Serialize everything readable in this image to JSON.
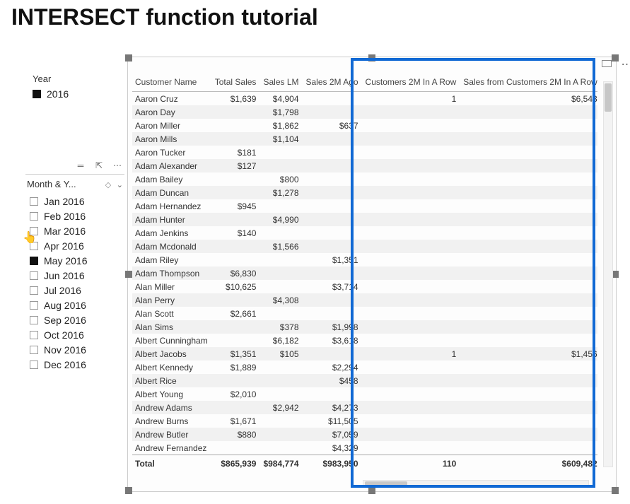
{
  "page": {
    "title": "INTERSECT function tutorial"
  },
  "year_slicer": {
    "label": "Year",
    "items": [
      {
        "label": "2016",
        "selected": true
      }
    ]
  },
  "month_slicer": {
    "title": "Month & Y...",
    "items": [
      {
        "label": "Jan 2016",
        "selected": false
      },
      {
        "label": "Feb 2016",
        "selected": false
      },
      {
        "label": "Mar 2016",
        "selected": false
      },
      {
        "label": "Apr 2016",
        "selected": false
      },
      {
        "label": "May 2016",
        "selected": true
      },
      {
        "label": "Jun 2016",
        "selected": false
      },
      {
        "label": "Jul 2016",
        "selected": false
      },
      {
        "label": "Aug 2016",
        "selected": false
      },
      {
        "label": "Sep 2016",
        "selected": false
      },
      {
        "label": "Oct 2016",
        "selected": false
      },
      {
        "label": "Nov 2016",
        "selected": false
      },
      {
        "label": "Dec 2016",
        "selected": false
      }
    ]
  },
  "table": {
    "columns": [
      "Customer Name",
      "Total Sales",
      "Sales LM",
      "Sales 2M Ago",
      "Customers 2M In A Row",
      "Sales from Customers 2M In A Row"
    ],
    "rows": [
      {
        "name": "Aaron Cruz",
        "total": "$1,639",
        "lm": "$4,904",
        "ago": "",
        "cr": "1",
        "sf": "$6,543"
      },
      {
        "name": "Aaron Day",
        "total": "",
        "lm": "$1,798",
        "ago": "",
        "cr": "",
        "sf": ""
      },
      {
        "name": "Aaron Miller",
        "total": "",
        "lm": "$1,862",
        "ago": "$637",
        "cr": "",
        "sf": ""
      },
      {
        "name": "Aaron Mills",
        "total": "",
        "lm": "$1,104",
        "ago": "",
        "cr": "",
        "sf": ""
      },
      {
        "name": "Aaron Tucker",
        "total": "$181",
        "lm": "",
        "ago": "",
        "cr": "",
        "sf": ""
      },
      {
        "name": "Adam Alexander",
        "total": "$127",
        "lm": "",
        "ago": "",
        "cr": "",
        "sf": ""
      },
      {
        "name": "Adam Bailey",
        "total": "",
        "lm": "$800",
        "ago": "",
        "cr": "",
        "sf": ""
      },
      {
        "name": "Adam Duncan",
        "total": "",
        "lm": "$1,278",
        "ago": "",
        "cr": "",
        "sf": ""
      },
      {
        "name": "Adam Hernandez",
        "total": "$945",
        "lm": "",
        "ago": "",
        "cr": "",
        "sf": ""
      },
      {
        "name": "Adam Hunter",
        "total": "",
        "lm": "$4,990",
        "ago": "",
        "cr": "",
        "sf": ""
      },
      {
        "name": "Adam Jenkins",
        "total": "$140",
        "lm": "",
        "ago": "",
        "cr": "",
        "sf": ""
      },
      {
        "name": "Adam Mcdonald",
        "total": "",
        "lm": "$1,566",
        "ago": "",
        "cr": "",
        "sf": ""
      },
      {
        "name": "Adam Riley",
        "total": "",
        "lm": "",
        "ago": "$1,351",
        "cr": "",
        "sf": ""
      },
      {
        "name": "Adam Thompson",
        "total": "$6,830",
        "lm": "",
        "ago": "",
        "cr": "",
        "sf": ""
      },
      {
        "name": "Alan Miller",
        "total": "$10,625",
        "lm": "",
        "ago": "$3,714",
        "cr": "",
        "sf": ""
      },
      {
        "name": "Alan Perry",
        "total": "",
        "lm": "$4,308",
        "ago": "",
        "cr": "",
        "sf": ""
      },
      {
        "name": "Alan Scott",
        "total": "$2,661",
        "lm": "",
        "ago": "",
        "cr": "",
        "sf": ""
      },
      {
        "name": "Alan Sims",
        "total": "",
        "lm": "$378",
        "ago": "$1,998",
        "cr": "",
        "sf": ""
      },
      {
        "name": "Albert Cunningham",
        "total": "",
        "lm": "$6,182",
        "ago": "$3,618",
        "cr": "",
        "sf": ""
      },
      {
        "name": "Albert Jacobs",
        "total": "$1,351",
        "lm": "$105",
        "ago": "",
        "cr": "1",
        "sf": "$1,456"
      },
      {
        "name": "Albert Kennedy",
        "total": "$1,889",
        "lm": "",
        "ago": "$2,294",
        "cr": "",
        "sf": ""
      },
      {
        "name": "Albert Rice",
        "total": "",
        "lm": "",
        "ago": "$458",
        "cr": "",
        "sf": ""
      },
      {
        "name": "Albert Young",
        "total": "$2,010",
        "lm": "",
        "ago": "",
        "cr": "",
        "sf": ""
      },
      {
        "name": "Andrew Adams",
        "total": "",
        "lm": "$2,942",
        "ago": "$4,273",
        "cr": "",
        "sf": ""
      },
      {
        "name": "Andrew Burns",
        "total": "$1,671",
        "lm": "",
        "ago": "$11,505",
        "cr": "",
        "sf": ""
      },
      {
        "name": "Andrew Butler",
        "total": "$880",
        "lm": "",
        "ago": "$7,059",
        "cr": "",
        "sf": ""
      },
      {
        "name": "Andrew Fernandez",
        "total": "",
        "lm": "",
        "ago": "$4,329",
        "cr": "",
        "sf": ""
      }
    ],
    "totals": {
      "label": "Total",
      "total": "$865,939",
      "lm": "$984,774",
      "ago": "$983,950",
      "cr": "110",
      "sf": "$609,482"
    }
  }
}
